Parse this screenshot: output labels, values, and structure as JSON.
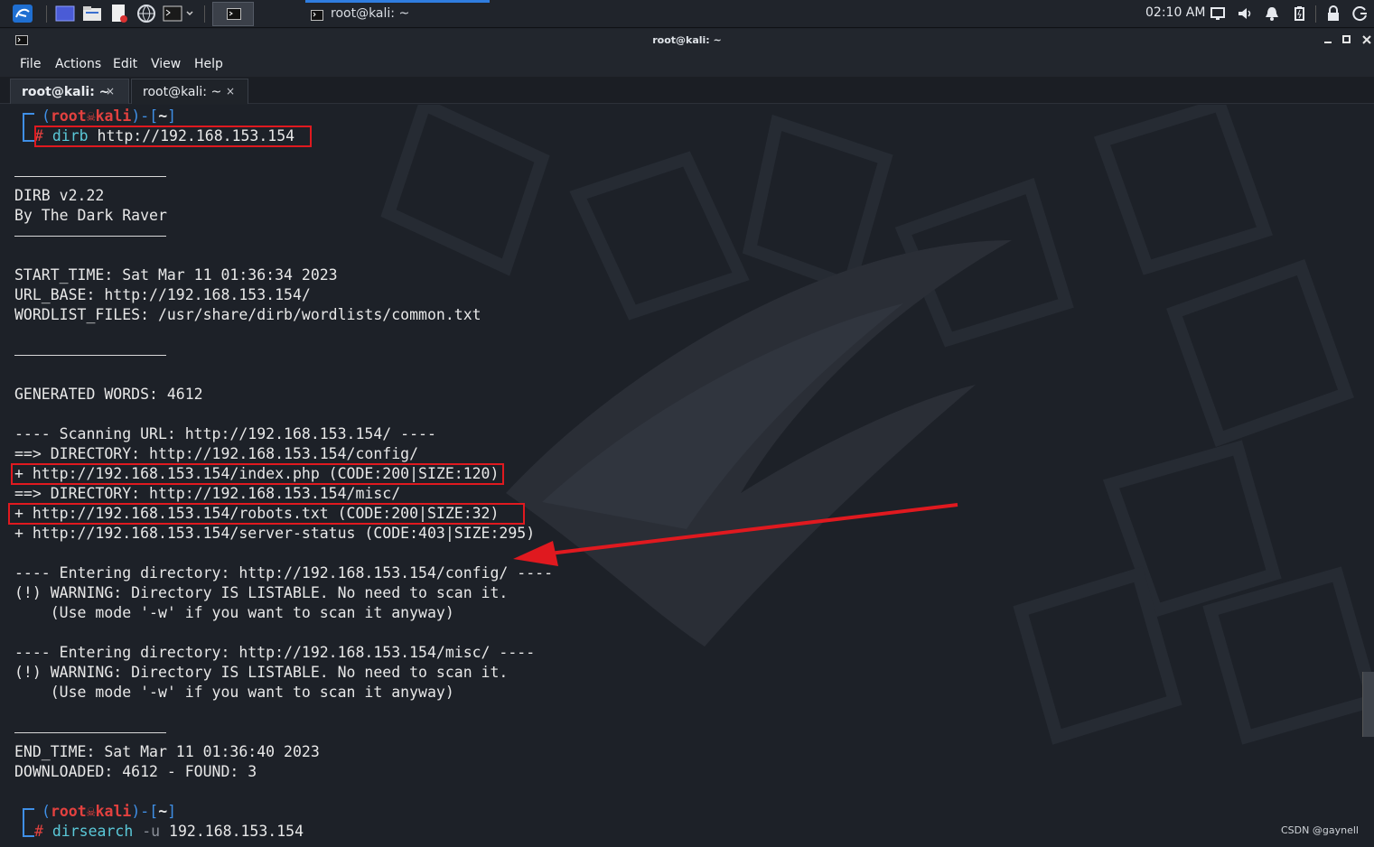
{
  "panel": {
    "task_window_title": "root@kali: ~",
    "clock": "02:10 AM",
    "icons": [
      "kali-menu-icon",
      "desktop-icon",
      "file-manager-icon",
      "text-editor-icon",
      "browser-icon",
      "terminal-icon",
      "volume-icon",
      "notifications-icon",
      "battery-icon",
      "lock-icon",
      "logout-icon"
    ]
  },
  "window": {
    "title": "root@kali: ~"
  },
  "menu": {
    "file": "File",
    "actions": "Actions",
    "edit": "Edit",
    "view": "View",
    "help": "Help"
  },
  "tabs": [
    {
      "label": "root@kali: ~",
      "close": "×"
    },
    {
      "label": "root@kali: ~",
      "close": "×"
    }
  ],
  "terminal": {
    "prompt1_user": "root",
    "prompt1_host": "kali",
    "prompt1_dir": "~",
    "cmd1_name": "dirb",
    "cmd1_args": " http://192.168.153.154",
    "l_version": "DIRB v2.22",
    "l_author": "By The Dark Raver",
    "l_start": "START_TIME: Sat Mar 11 01:36:34 2023",
    "l_urlbase": "URL_BASE: http://192.168.153.154/",
    "l_wordlist": "WORDLIST_FILES: /usr/share/dirb/wordlists/common.txt",
    "l_generated": "GENERATED WORDS: 4612",
    "l_scanning": "---- Scanning URL: http://192.168.153.154/ ----",
    "l_dir_config": "==> DIRECTORY: http://192.168.153.154/config/",
    "l_index": "+ http://192.168.153.154/index.php (CODE:200|SIZE:120)",
    "l_dir_misc": "==> DIRECTORY: http://192.168.153.154/misc/",
    "l_robots": "+ http://192.168.153.154/robots.txt (CODE:200|SIZE:32)",
    "l_status": "+ http://192.168.153.154/server-status (CODE:403|SIZE:295)",
    "l_enter_config": "---- Entering directory: http://192.168.153.154/config/ ----",
    "l_warn1": "(!) WARNING: Directory IS LISTABLE. No need to scan it.",
    "l_mode1": "    (Use mode '-w' if you want to scan it anyway)",
    "l_enter_misc": "---- Entering directory: http://192.168.153.154/misc/ ----",
    "l_warn2": "(!) WARNING: Directory IS LISTABLE. No need to scan it.",
    "l_mode2": "    (Use mode '-w' if you want to scan it anyway)",
    "l_end": "END_TIME: Sat Mar 11 01:36:40 2023",
    "l_downloaded": "DOWNLOADED: 4612 - FOUND: 3",
    "prompt2_user": "root",
    "prompt2_host": "kali",
    "prompt2_dir": "~",
    "cmd2_name": "dirsearch",
    "cmd2_flag": " -u",
    "cmd2_args": " 192.168.153.154"
  },
  "watermark": "CSDN @gaynell",
  "colors": {
    "annotation_red": "#e0191f",
    "prompt_red": "#e3413f",
    "prompt_blue": "#3f8fe6",
    "command_cyan": "#5ac8d8",
    "terminal_bg": "#1d2128"
  }
}
